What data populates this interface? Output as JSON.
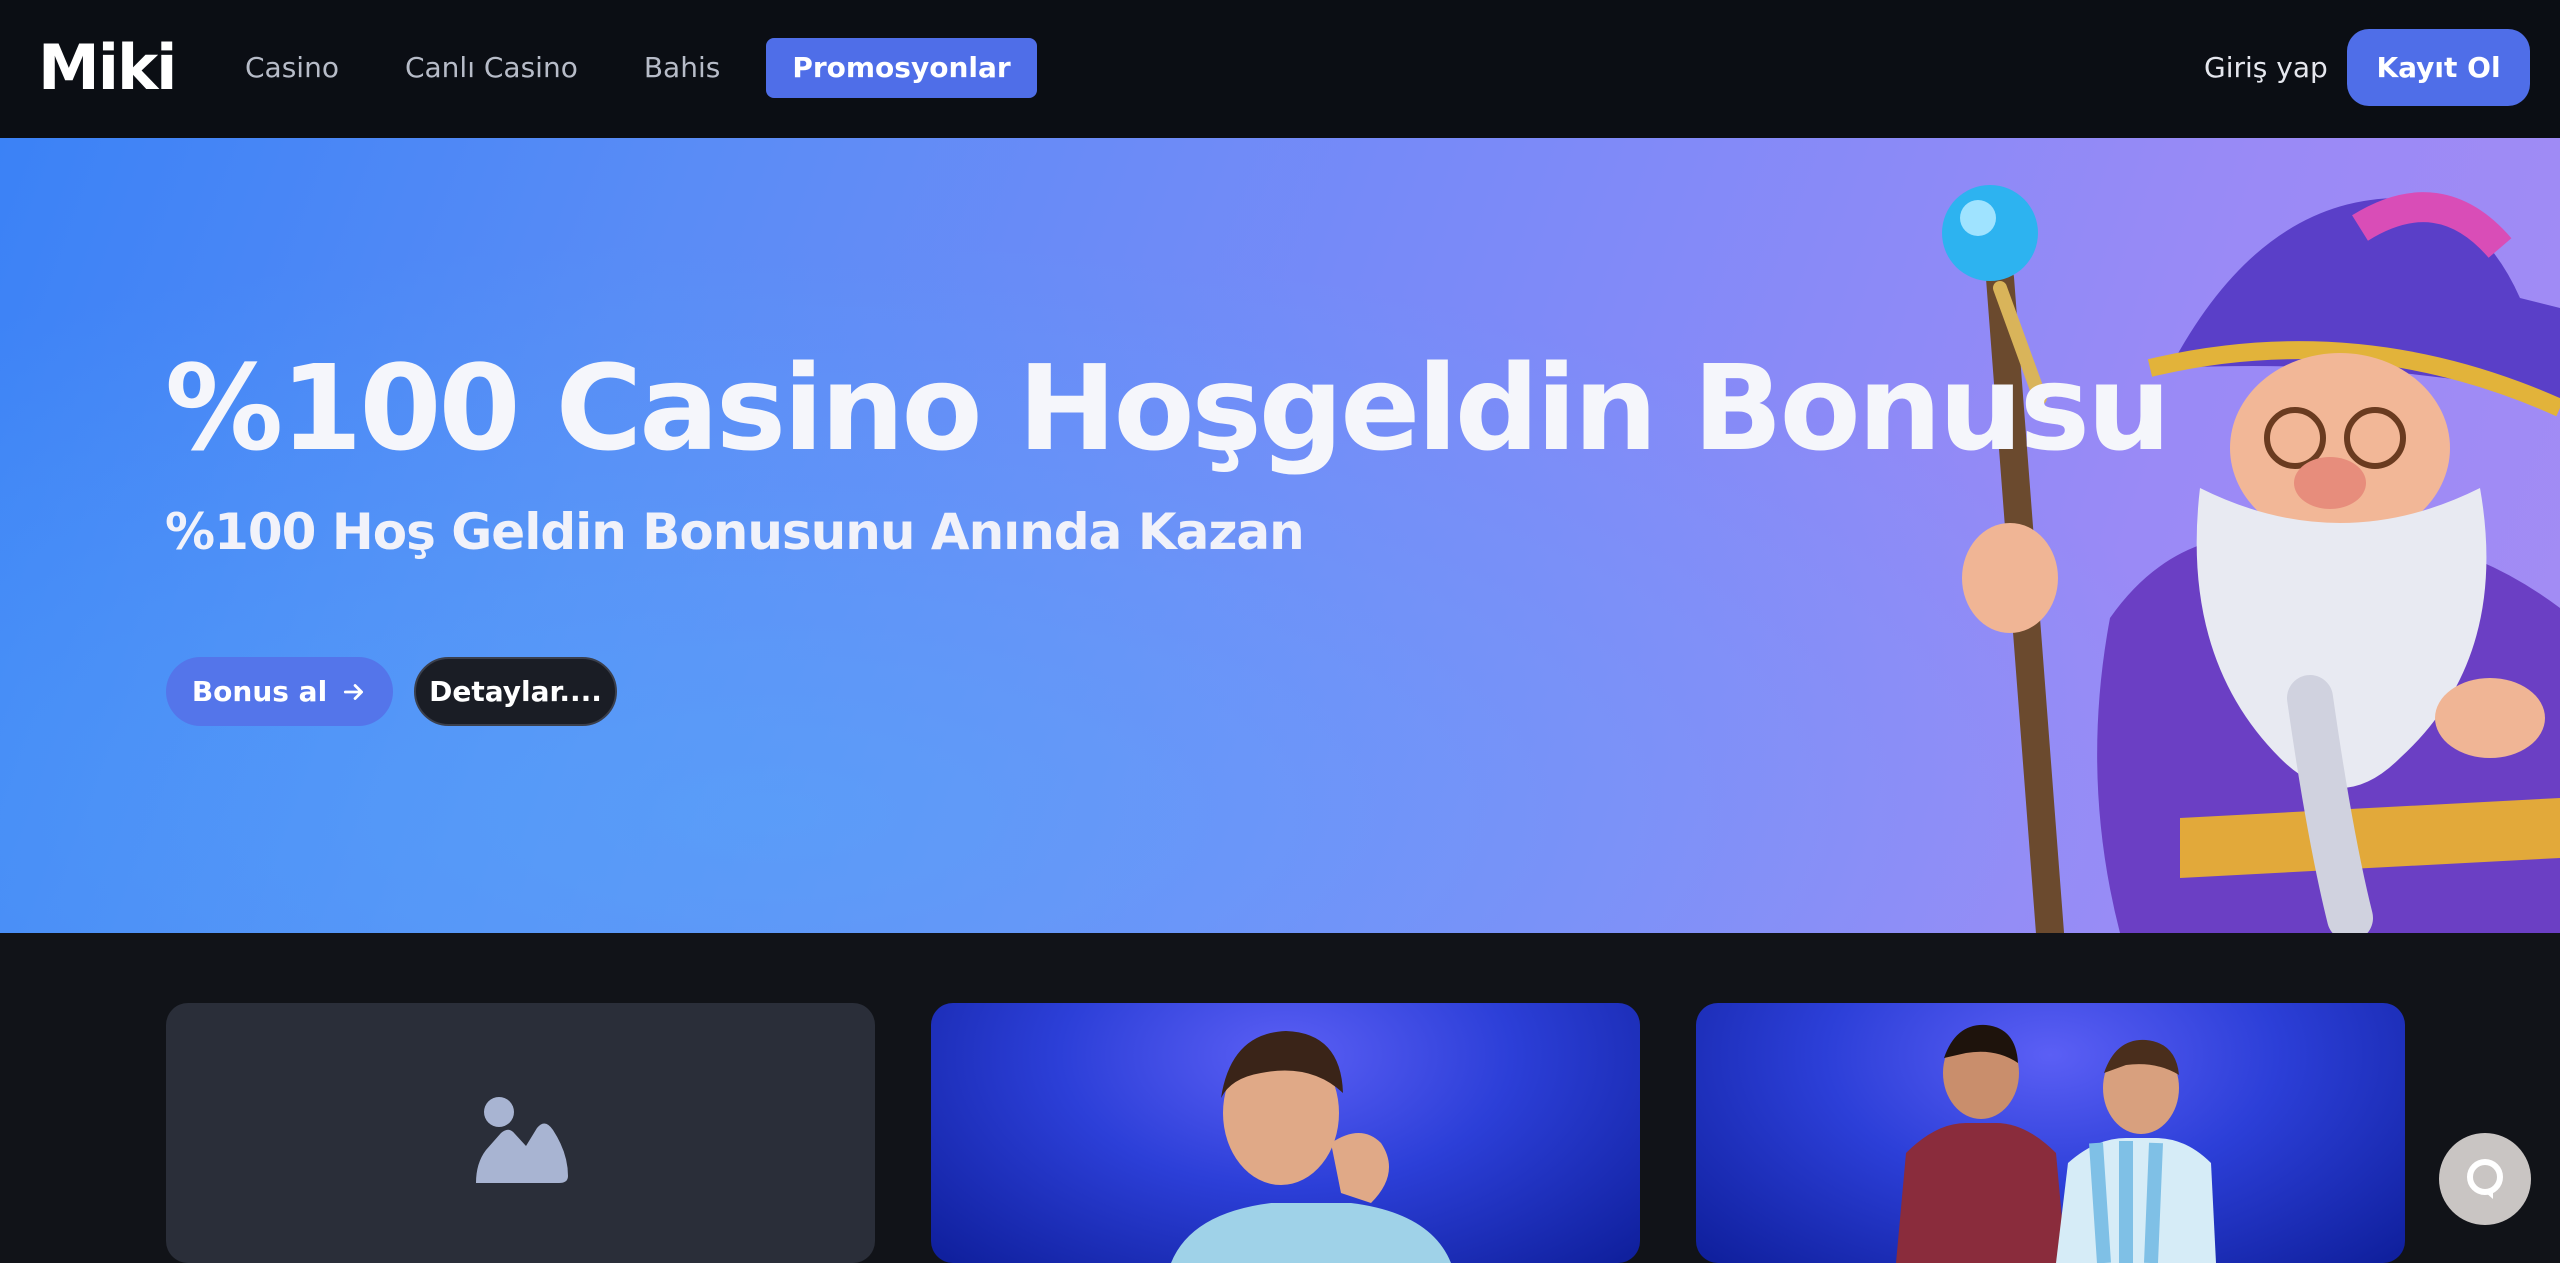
{
  "header": {
    "logo": "Miki",
    "nav": [
      {
        "label": "Casino",
        "active": false
      },
      {
        "label": "Canlı Casino",
        "active": false
      },
      {
        "label": "Bahis",
        "active": false
      },
      {
        "label": "Promosyonlar",
        "active": true
      }
    ],
    "login_label": "Giriş yap",
    "signup_label": "Kayıt Ol"
  },
  "hero": {
    "title": "%100 Casino Hoşgeldin Bonusu",
    "subtitle": "%100 Hoş Geldin Bonusunu Anında Kazan",
    "primary_button": "Bonus al",
    "secondary_button": "Detaylar...."
  },
  "cards": [
    {
      "image": "image-placeholder-icon"
    },
    {
      "image": "promo-player-photo"
    },
    {
      "image": "promo-footballers-photo"
    }
  ],
  "colors": {
    "accent": "#4f6ee8",
    "header_bg": "#0b0e14",
    "page_bg": "#111318"
  }
}
